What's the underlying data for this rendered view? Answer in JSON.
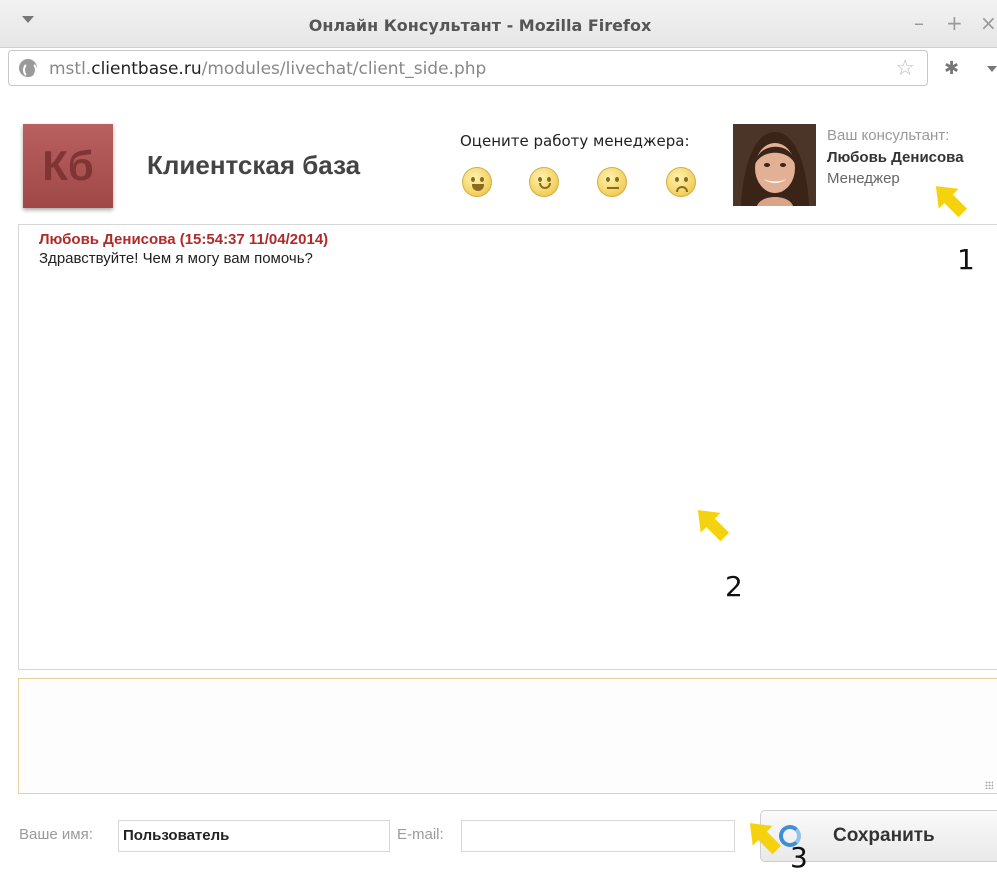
{
  "browser": {
    "window_title": "Онлайн Консультант - Mozilla Firefox",
    "url_prefix": "mstl.",
    "url_domain": "clientbase.ru",
    "url_path": "/modules/livechat/client_side.php",
    "controls": {
      "minimize": "–",
      "maximize": "+",
      "close": "×"
    }
  },
  "header": {
    "logo_text": "Кб",
    "brand_name": "Клиентская база",
    "rate_label": "Оцените работу менеджера:",
    "ratings": [
      "very-happy-smiley-icon",
      "smile-smiley-icon",
      "neutral-smiley-icon",
      "sad-smiley-icon"
    ]
  },
  "consultant": {
    "label": "Ваш консультант:",
    "name": "Любовь Денисова",
    "role": "Менеджер"
  },
  "chat": {
    "messages": [
      {
        "header": "Любовь Денисова (15:54:37 11/04/2014)",
        "text": "Здравствуйте! Чем я могу вам помочь?"
      }
    ]
  },
  "form": {
    "name_label": "Ваше имя:",
    "name_value": "Пользователь",
    "email_label": "E-mail:",
    "email_value": "",
    "save_label": "Сохранить"
  },
  "annotations": {
    "n1": "1",
    "n2": "2",
    "n3": "3"
  },
  "colors": {
    "arrow": "#f4d20d",
    "logo": "#a84d4d",
    "message_author": "#b02a2a"
  }
}
